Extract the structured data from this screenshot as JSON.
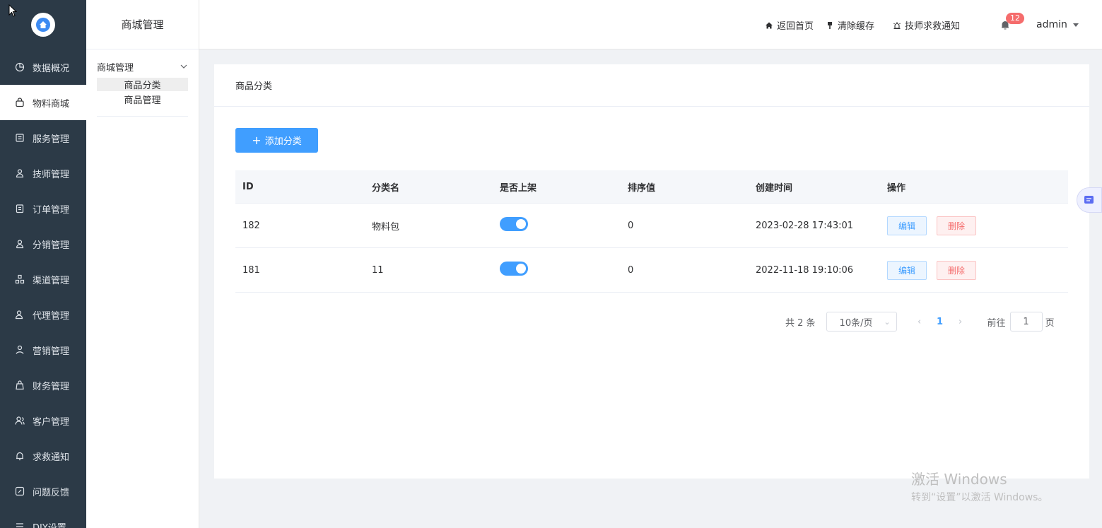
{
  "nav": {
    "items": [
      {
        "label": "数据概况",
        "icon": "pie-chart-icon"
      },
      {
        "label": "物料商城",
        "icon": "shopping-bag-icon"
      },
      {
        "label": "服务管理",
        "icon": "service-icon"
      },
      {
        "label": "技师管理",
        "icon": "technician-icon"
      },
      {
        "label": "订单管理",
        "icon": "order-icon"
      },
      {
        "label": "分销管理",
        "icon": "distribution-icon"
      },
      {
        "label": "渠道管理",
        "icon": "channel-icon"
      },
      {
        "label": "代理管理",
        "icon": "agent-icon"
      },
      {
        "label": "营销管理",
        "icon": "marketing-icon"
      },
      {
        "label": "财务管理",
        "icon": "finance-icon"
      },
      {
        "label": "客户管理",
        "icon": "customer-icon"
      },
      {
        "label": "求救通知",
        "icon": "bell-icon"
      },
      {
        "label": "问题反馈",
        "icon": "feedback-icon"
      },
      {
        "label": "DIY设置",
        "icon": "diy-icon"
      }
    ]
  },
  "submenu": {
    "title": "商城管理",
    "group_label": "商城管理",
    "links": [
      "商品分类",
      "商品管理"
    ]
  },
  "header": {
    "home": "返回首页",
    "clear_cache": "清除缓存",
    "sos_notice": "技师求救通知",
    "badge_count": "12",
    "user": "admin"
  },
  "card": {
    "title": "商品分类",
    "add_button": "添加分类"
  },
  "table": {
    "headers": [
      "ID",
      "分类名",
      "是否上架",
      "排序值",
      "创建时间",
      "操作"
    ],
    "rows": [
      {
        "id": "182",
        "name": "物料包",
        "on_shelf": true,
        "sort": "0",
        "created": "2023-02-28 17:43:01"
      },
      {
        "id": "181",
        "name": "11",
        "on_shelf": true,
        "sort": "0",
        "created": "2022-11-18 19:10:06"
      }
    ],
    "edit_label": "编辑",
    "delete_label": "删除"
  },
  "pager": {
    "total": "共 2 条",
    "page_size": "10条/页",
    "current": "1",
    "goto_prefix": "前往",
    "goto_value": "1",
    "goto_suffix": "页"
  },
  "watermark": {
    "line1": "激活 Windows",
    "line2": "转到“设置”以激活 Windows。"
  },
  "colors": {
    "nav_bg": "#2c3a47",
    "primary": "#409eff",
    "danger": "#f56c6c"
  }
}
